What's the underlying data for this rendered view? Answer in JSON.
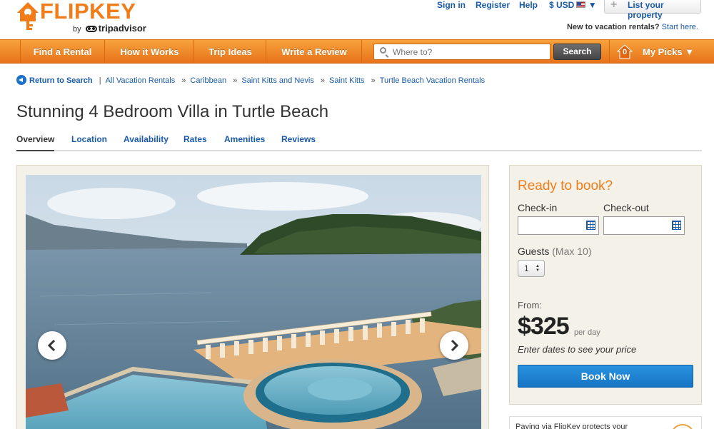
{
  "brand": {
    "name": "FLIPKEY",
    "by": "by",
    "partner": "tripadvisor",
    "accent": "#f07d1a",
    "link_color": "#1a5aa8"
  },
  "topnav": {
    "sign_in": "Sign in",
    "register": "Register",
    "help": "Help",
    "currency": "$ USD",
    "currency_caret": "▼",
    "list_property": "List your property",
    "new_prompt": "New to vacation rentals?",
    "start_here": "Start here."
  },
  "mainnav": {
    "items": [
      "Find a Rental",
      "How it Works",
      "Trip Ideas",
      "Write a Review"
    ],
    "search_placeholder": "Where to?",
    "search_button": "Search",
    "picks_count": "0",
    "my_picks": "My Picks ▼"
  },
  "breadcrumb": {
    "return": "Return to Search",
    "divider": "|",
    "sep": "»",
    "items": [
      "All Vacation Rentals",
      "Caribbean",
      "Saint Kitts and Nevis",
      "Saint Kitts",
      "Turtle Beach Vacation Rentals"
    ]
  },
  "listing": {
    "title": "Stunning 4 Bedroom Villa in Turtle Beach"
  },
  "tabs": [
    "Overview",
    "Location",
    "Availability",
    "Rates",
    "Amenities",
    "Reviews"
  ],
  "booking": {
    "heading": "Ready to book?",
    "checkin_label": "Check-in",
    "checkout_label": "Check-out",
    "guests_label": "Guests",
    "guests_max": "(Max 10)",
    "guests_value": "1",
    "from_label": "From:",
    "price": "$325",
    "per": "per day",
    "note": "Enter dates to see your price",
    "book_button": "Book Now"
  },
  "protect": {
    "text": "Paying via FlipKey protects your"
  },
  "icons": {
    "logo": "house-key-icon",
    "search": "search-icon",
    "calendar": "calendar-icon",
    "back": "back-arrow-icon",
    "prev": "chevron-left-icon",
    "next": "chevron-right-icon",
    "picks": "house-icon",
    "plus": "plus-icon"
  }
}
